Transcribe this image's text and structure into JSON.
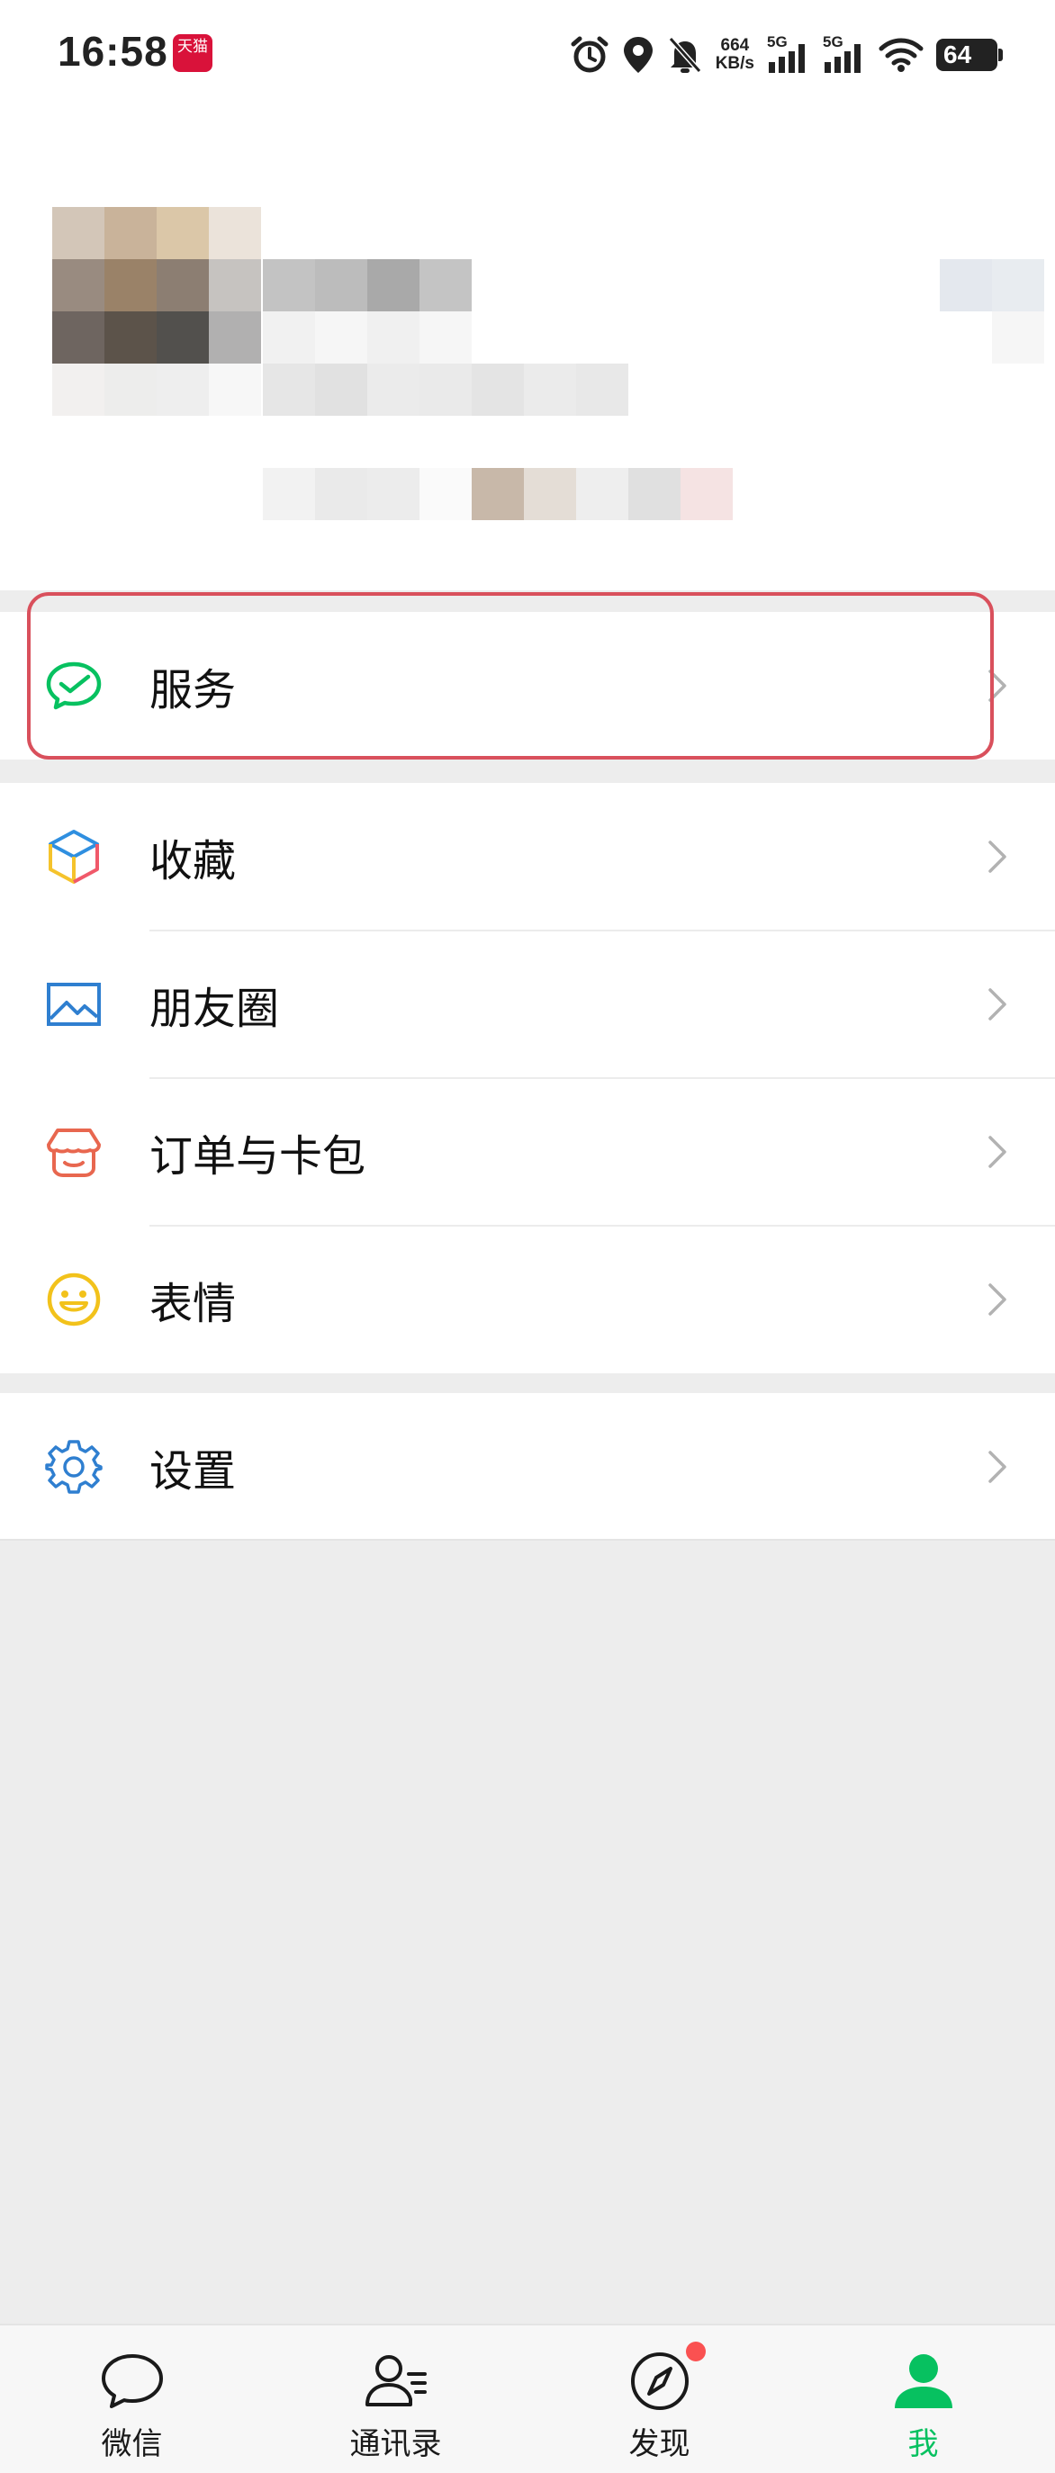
{
  "status_bar": {
    "time": "16:58",
    "tmall_label": "天猫",
    "net_speed_value": "664",
    "net_speed_unit": "KB/s",
    "signal_1_label": "5G",
    "signal_2_label": "5G",
    "battery": "64",
    "icons": [
      "alarm-icon",
      "location-icon",
      "mute-bell-icon",
      "signal-icon",
      "wifi-icon",
      "battery-icon"
    ]
  },
  "profile": {
    "note": ""
  },
  "services_group": {
    "items": [
      {
        "label": "服务",
        "icon": "wechat-pay-service-icon"
      }
    ]
  },
  "main_group": {
    "items": [
      {
        "label": "收藏",
        "icon": "favorites-cube-icon"
      },
      {
        "label": "朋友圈",
        "icon": "moments-picture-icon"
      },
      {
        "label": "订单与卡包",
        "icon": "orders-shop-icon"
      },
      {
        "label": "表情",
        "icon": "smiley-icon"
      }
    ]
  },
  "settings_group": {
    "items": [
      {
        "label": "设置",
        "icon": "gear-icon"
      }
    ]
  },
  "colors": {
    "accent_green": "#07c160",
    "highlight_red": "#d9505c",
    "badge_red": "#fa5151",
    "background": "#ededed"
  },
  "tabbar": {
    "tabs": [
      {
        "label": "微信",
        "icon": "chat-bubble-icon",
        "active": false
      },
      {
        "label": "通讯录",
        "icon": "contacts-icon",
        "active": false
      },
      {
        "label": "发现",
        "icon": "compass-icon",
        "active": false,
        "badge_dot": true
      },
      {
        "label": "我",
        "icon": "person-icon",
        "active": true
      }
    ]
  }
}
